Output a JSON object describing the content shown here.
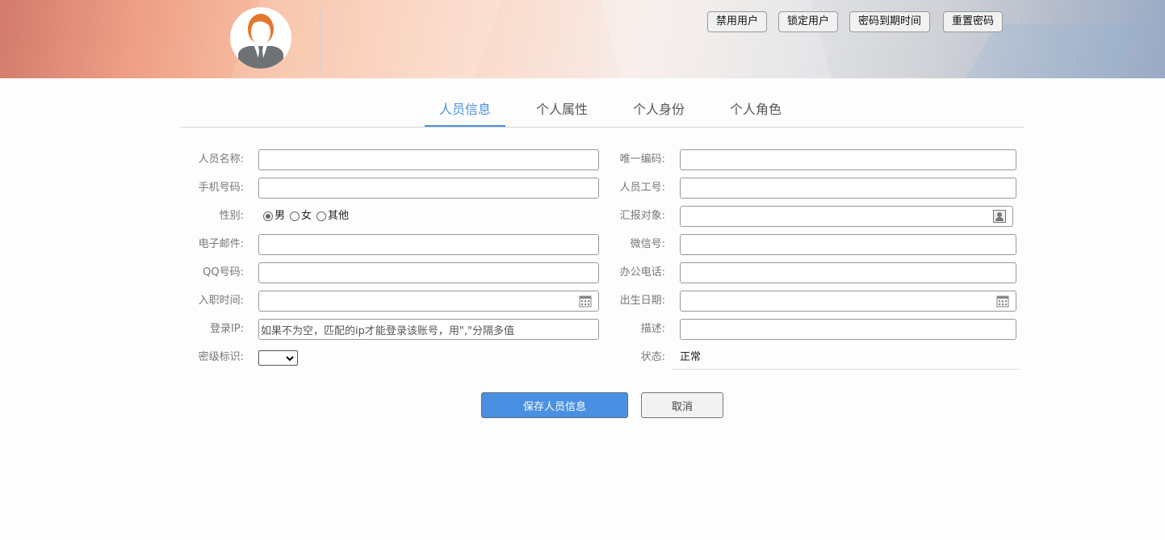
{
  "header": {
    "buttons": [
      "禁用用户",
      "锁定用户",
      "密码到期时间",
      "重置密码"
    ]
  },
  "tabs": [
    {
      "label": "人员信息",
      "active": true
    },
    {
      "label": "个人属性"
    },
    {
      "label": "个人身份"
    },
    {
      "label": "个人角色"
    }
  ],
  "form": {
    "left": {
      "name": {
        "label": "人员名称:",
        "value": ""
      },
      "mobile": {
        "label": "手机号码:",
        "value": ""
      },
      "gender": {
        "label": "性别:",
        "options": [
          "男",
          "女",
          "其他"
        ],
        "selected": "男"
      },
      "email": {
        "label": "电子邮件:",
        "value": ""
      },
      "qq": {
        "label": "QQ号码:",
        "value": ""
      },
      "hire_date": {
        "label": "入职时间:",
        "value": ""
      },
      "login_ip": {
        "label": "登录IP:",
        "value": "如果不为空，匹配的ip才能登录该账号，用\",\"分隔多值"
      },
      "security_level": {
        "label": "密级标识:",
        "value": ""
      }
    },
    "right": {
      "unique_code": {
        "label": "唯一编码:",
        "value": ""
      },
      "employee_no": {
        "label": "人员工号:",
        "value": ""
      },
      "report_to": {
        "label": "汇报对象:",
        "value": ""
      },
      "wechat": {
        "label": "微信号:",
        "value": ""
      },
      "office_phone": {
        "label": "办公电话:",
        "value": ""
      },
      "birth_date": {
        "label": "出生日期:",
        "value": ""
      },
      "description": {
        "label": "描述:",
        "value": ""
      },
      "status": {
        "label": "状态:",
        "value": "正常"
      }
    }
  },
  "actions": {
    "save": "保存人员信息",
    "cancel": "取消"
  },
  "colors": {
    "accent": "#4a90e2",
    "avatar_hair": "#e0772d",
    "avatar_suit": "#6e7275"
  }
}
